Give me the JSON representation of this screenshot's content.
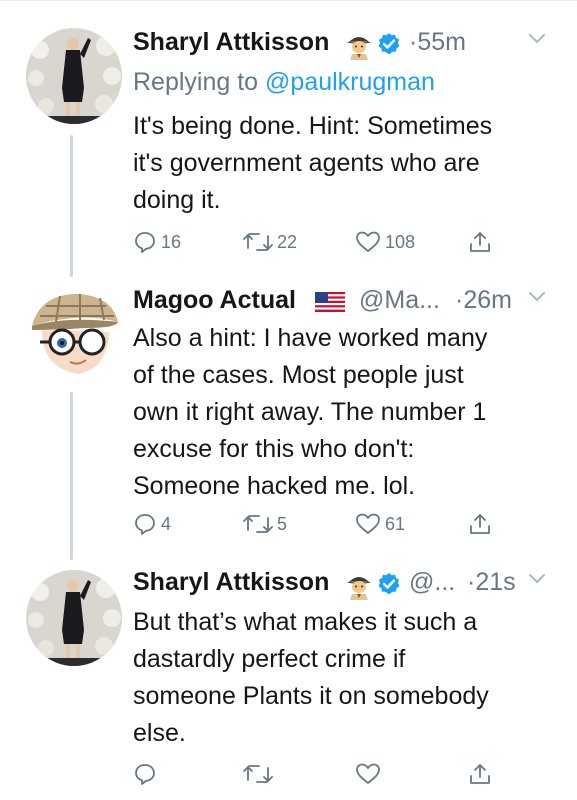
{
  "tweets": [
    {
      "name": "Sharyl Attkisson",
      "handle": "",
      "time": "·55m",
      "reply_prefix": "Replying to ",
      "reply_to": "@paulkrugman",
      "text_lines": [
        "It's being done. Hint: Sometimes",
        "it's government agents who are",
        "doing it."
      ],
      "replies": "16",
      "retweets": "22",
      "likes": "108"
    },
    {
      "name": "Magoo Actual",
      "handle": "@Ma...",
      "time": "·26m",
      "text_lines": [
        "Also a hint: I have worked many",
        "of the cases. Most people just",
        "own it right away. The number 1",
        "excuse for this who don't:",
        "Someone hacked me. lol."
      ],
      "replies": "4",
      "retweets": "5",
      "likes": "61"
    },
    {
      "name": "Sharyl Attkisson",
      "handle": "@...",
      "time": "·21s",
      "text_lines": [
        "But that’s what makes it such a",
        "dastardly perfect crime if",
        "someone Plants it on somebody",
        "else."
      ],
      "replies": "",
      "retweets": "",
      "likes": ""
    }
  ],
  "icons": {
    "detective_emoji": "detective-icon",
    "verified_badge": "verified-icon",
    "flag_emoji": "us-flag-icon",
    "more": "chevron-down-icon",
    "reply": "reply-icon",
    "retweet": "retweet-icon",
    "like": "heart-icon",
    "share": "share-icon"
  },
  "colors": {
    "link": "#1da1f2",
    "secondary_text": "#657786",
    "thread_line": "#ccd6dd"
  }
}
